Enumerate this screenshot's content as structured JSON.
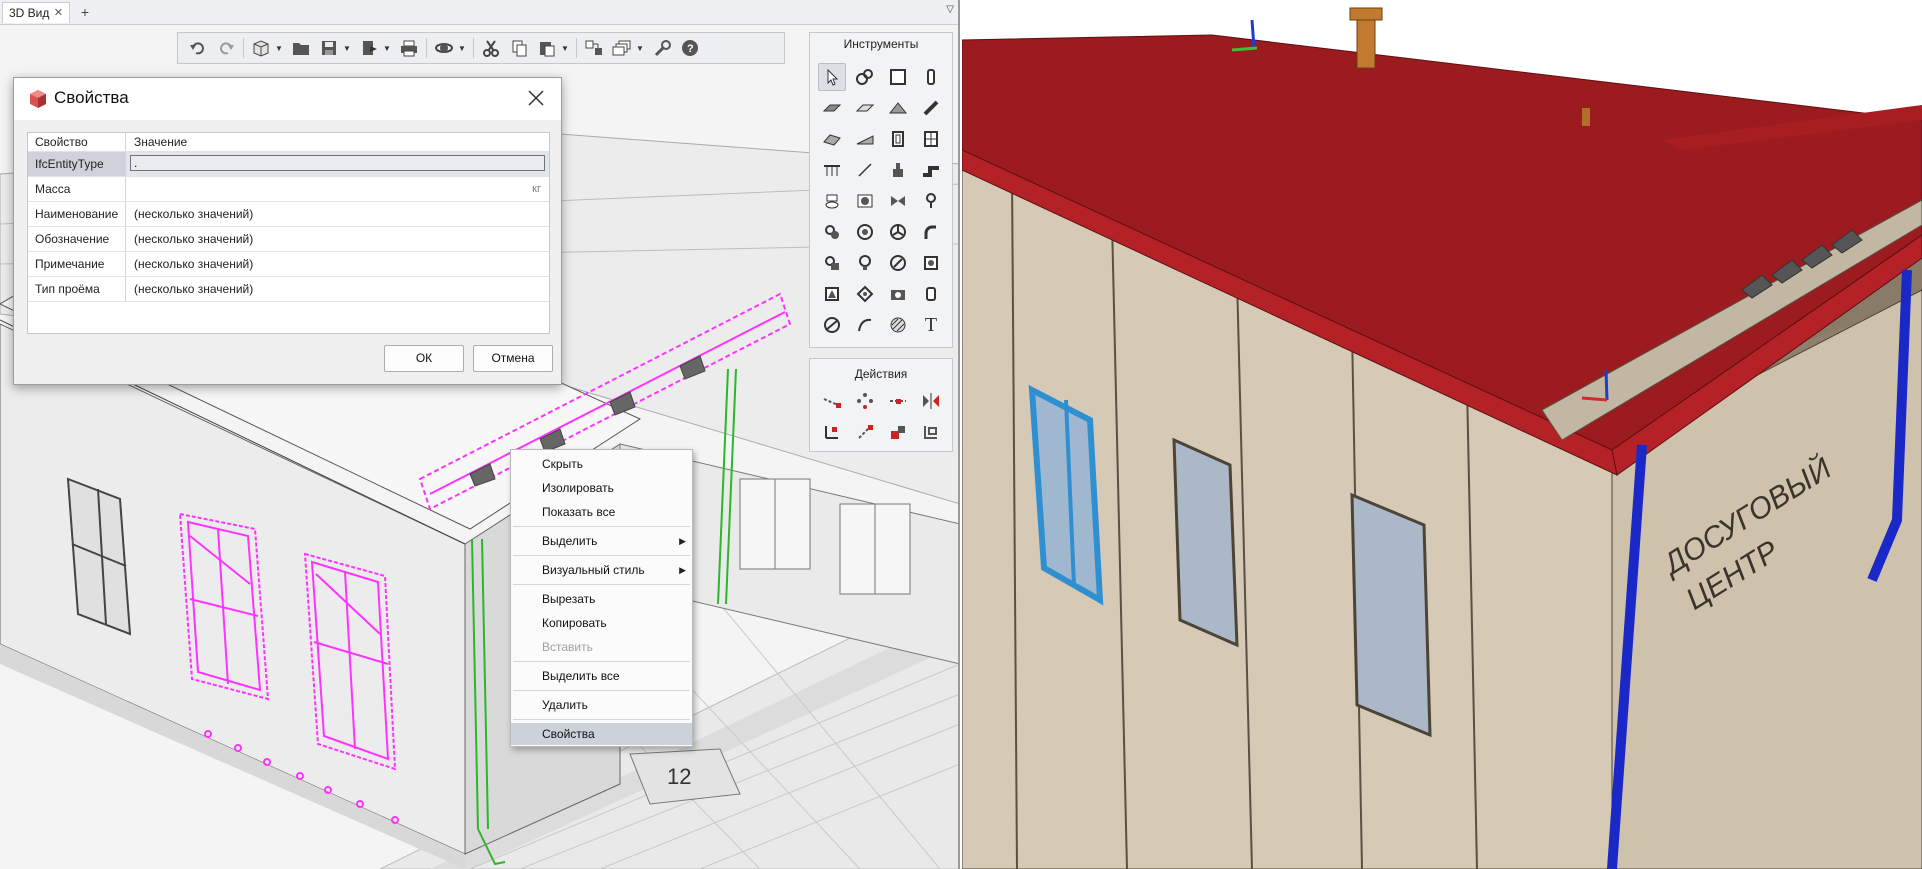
{
  "tabs": {
    "active_label": "3D Вид",
    "close_glyph": "✕",
    "add_glyph": "+",
    "menu_glyph": "▽"
  },
  "toolbar": {
    "icons": [
      "undo-icon",
      "redo-icon",
      "3d-box-icon",
      "open-folder-icon",
      "save-icon",
      "export-icon",
      "print-icon",
      "orbit-icon",
      "cut-icon",
      "copy-icon",
      "paste-icon",
      "link-model-icon",
      "layers-icon",
      "wrench-icon",
      "help-icon"
    ]
  },
  "tools_panel": {
    "title": "Инструменты",
    "text_tool_glyph": "T"
  },
  "actions_panel": {
    "title": "Действия"
  },
  "dialog": {
    "title": "Свойства",
    "header_property": "Свойство",
    "header_value": "Значение",
    "rows": [
      {
        "name": "IfcEntityType",
        "value": "."
      },
      {
        "name": "Масса",
        "value": "",
        "unit": "кг"
      },
      {
        "name": "Наименование",
        "value": "(несколько значений)"
      },
      {
        "name": "Обозначение",
        "value": "(несколько значений)"
      },
      {
        "name": "Примечание",
        "value": "(несколько значений)"
      },
      {
        "name": "Тип проёма",
        "value": "(несколько значений)"
      }
    ],
    "ok_label": "ОК",
    "cancel_label": "Отмена"
  },
  "context_menu": {
    "items": [
      {
        "label": "Скрыть"
      },
      {
        "label": "Изолировать"
      },
      {
        "label": "Показать все"
      },
      {
        "label": "Выделить",
        "submenu": true
      },
      {
        "label": "Визуальный стиль",
        "submenu": true
      },
      {
        "label": "Вырезать"
      },
      {
        "label": "Копировать"
      },
      {
        "label": "Вставить",
        "disabled": true
      },
      {
        "label": "Выделить все"
      },
      {
        "label": "Удалить"
      },
      {
        "label": "Свойства",
        "highlighted": true
      }
    ],
    "submenu_glyph": "▶"
  },
  "viewport_left": {
    "plan_label": "12"
  },
  "viewport_right": {
    "sign_line1": "ДОСУГОВЫЙ",
    "sign_line2": "ЦЕНТР"
  },
  "colors": {
    "selection": "#ff33ff",
    "roof": "#9c1b1f",
    "wall": "#d8ccb8",
    "pipe": "#1a28c8",
    "window_sel": "#2f8fd0"
  }
}
